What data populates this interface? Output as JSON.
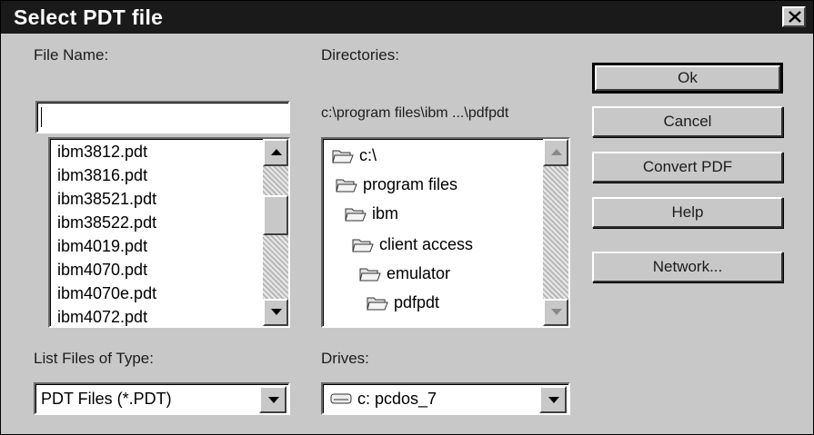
{
  "dialog": {
    "title": "Select PDT file"
  },
  "file_name": {
    "label": "File Name:",
    "value": "",
    "items": [
      "ibm3812.pdt",
      "ibm3816.pdt",
      "ibm38521.pdt",
      "ibm38522.pdt",
      "ibm4019.pdt",
      "ibm4070.pdt",
      "ibm4070e.pdt",
      "ibm4072.pdt"
    ]
  },
  "directories": {
    "label": "Directories:",
    "path": "c:\\program files\\ibm ...\\pdfpdt",
    "items": [
      "c:\\",
      "program files",
      "ibm",
      "client access",
      "emulator",
      "pdfpdt"
    ]
  },
  "buttons": {
    "ok": "Ok",
    "cancel": "Cancel",
    "convert": "Convert PDF",
    "help": "Help",
    "network": "Network..."
  },
  "file_type": {
    "label": "List Files of Type:",
    "selected": "PDT Files (*.PDT)"
  },
  "drives": {
    "label": "Drives:",
    "selected": "c: pcdos_7"
  },
  "icons": {
    "folder": "folder-icon",
    "drive": "drive-icon",
    "close": "close-icon"
  }
}
